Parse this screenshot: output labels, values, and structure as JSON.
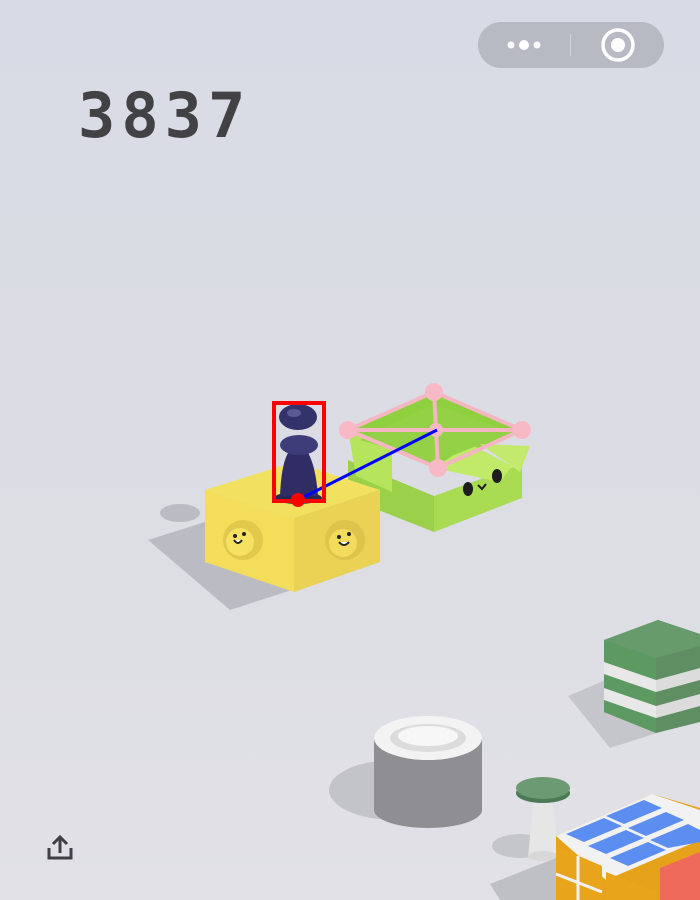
{
  "hud": {
    "score": "3837",
    "menu_icon": "more-dots-icon",
    "close_icon": "target-circle-icon",
    "share_icon": "share-upload-icon"
  },
  "scene": {
    "player": "dark-chess-pawn",
    "current_block": "yellow-smiley-cube",
    "target_block": "green-paper-box",
    "blocks": [
      "white-cylinder-plate",
      "green-striped-stack",
      "mushroom-stool",
      "rubiks-cube"
    ]
  },
  "overlay_colors": {
    "bbox": "#ff0000",
    "aim_line": "#0000ff",
    "target_points": "#ffc0cb"
  }
}
